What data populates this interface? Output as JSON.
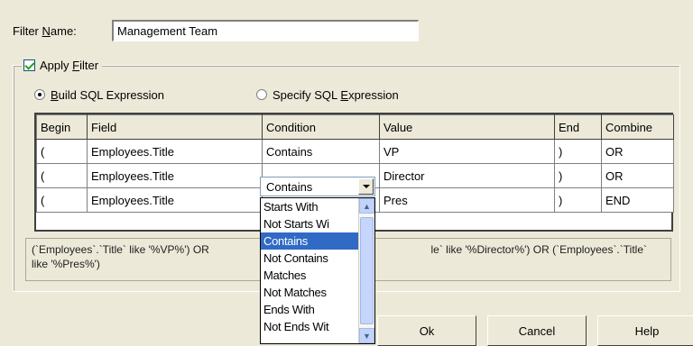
{
  "filter": {
    "name_label_pre": "Filter ",
    "name_label_ul": "N",
    "name_label_post": "ame:",
    "name_value": "Management Team"
  },
  "apply_filter": {
    "label_pre": "Apply ",
    "label_ul": "F",
    "label_post": "ilter",
    "checked": true
  },
  "mode": {
    "build_ul": "B",
    "build_rest": "uild SQL Expression",
    "specify_pre": "Specify SQL ",
    "specify_ul": "E",
    "specify_post": "xpression",
    "selected": "build"
  },
  "grid": {
    "columns": [
      "Begin",
      "Field",
      "Condition",
      "Value",
      "End",
      "Combine"
    ],
    "rows": [
      {
        "begin": "(",
        "field": "Employees.Title",
        "condition": "Contains",
        "value": "VP",
        "end": ")",
        "combine": "OR"
      },
      {
        "begin": "(",
        "field": "Employees.Title",
        "condition": "Contains",
        "value": "Director",
        "end": ")",
        "combine": "OR"
      },
      {
        "begin": "(",
        "field": "Employees.Title",
        "condition": "",
        "value": "Pres",
        "end": ")",
        "combine": "END"
      }
    ]
  },
  "condition_dropdown": {
    "value": "Contains",
    "options": [
      "Starts With",
      "Not Starts Wi",
      "Contains",
      "Not Contains",
      "Matches",
      "Not Matches",
      "Ends With",
      "Not Ends Wit"
    ],
    "selected_index": 2
  },
  "sql_preview": {
    "line1_left": "(`Employees`.`Title` like '%VP%') OR",
    "line1_right": "le` like '%Director%') OR (`Employees`.`Title`",
    "line2": "like '%Pres%')"
  },
  "buttons": {
    "ok": "Ok",
    "cancel": "Cancel",
    "help": "Help"
  },
  "icons": {
    "scroll_up": "scroll-up-arrow-icon",
    "scroll_down": "scroll-down-arrow-icon",
    "combo_arrow": "chevron-down-icon"
  }
}
